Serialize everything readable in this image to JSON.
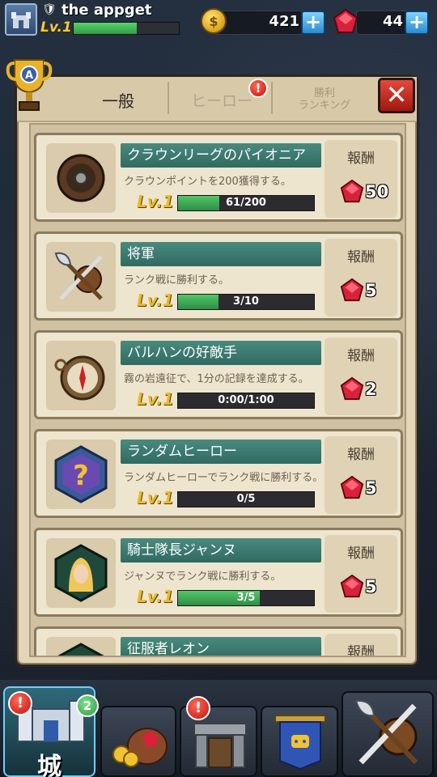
{
  "player": {
    "name": "the appget",
    "level": "Lv.1",
    "xp_fraction": 0.6
  },
  "currency": {
    "coins": "421",
    "gems": "44"
  },
  "tabs": {
    "general": "一般",
    "hero": "ヒーロー",
    "ranking_line1": "勝利",
    "ranking_line2": "ランキング",
    "alert": "!"
  },
  "quests": [
    {
      "title": "クラウンリーグのパイオニア",
      "description": "クラウンポイントを200獲得する。",
      "level": "Lv.1",
      "progress": "61/200",
      "progress_fraction": 0.305,
      "reward_label": "報酬",
      "reward_amount": "50",
      "icon": "shield-icon"
    },
    {
      "title": "将軍",
      "description": "ランク戦に勝利する。",
      "level": "Lv.1",
      "progress": "3/10",
      "progress_fraction": 0.3,
      "reward_label": "報酬",
      "reward_amount": "5",
      "icon": "crossed-weapons-icon"
    },
    {
      "title": "バルハンの好敵手",
      "description": "霧の岩遠征で、1分の記録を達成する。",
      "level": "Lv.1",
      "progress": "0:00/1:00",
      "progress_fraction": 0,
      "reward_label": "報酬",
      "reward_amount": "2",
      "icon": "compass-icon"
    },
    {
      "title": "ランダムヒーロー",
      "description": "ランダムヒーローでランク戦に勝利する。",
      "level": "Lv.1",
      "progress": "0/5",
      "progress_fraction": 0,
      "reward_label": "報酬",
      "reward_amount": "5",
      "icon": "question-mark-icon"
    },
    {
      "title": "騎士隊長ジャンヌ",
      "description": "ジャンヌでランク戦に勝利する。",
      "level": "Lv.1",
      "progress": "3/5",
      "progress_fraction": 0.6,
      "reward_label": "報酬",
      "reward_amount": "5",
      "icon": "hero-portrait-icon"
    },
    {
      "title": "征服者レオン",
      "description": "",
      "level": "",
      "progress": "",
      "progress_fraction": 0,
      "reward_label": "報酬",
      "reward_amount": "",
      "icon": "hero-portrait-icon"
    }
  ],
  "bottom_nav": {
    "castle_label": "城",
    "castle_alert": "!",
    "castle_count": "2",
    "dungeon_alert": "!"
  },
  "colors": {
    "accent_teal": "#2f6a61",
    "gem_red": "#c4122a",
    "level_gold": "#e8b92c",
    "progress_green": "#52c768"
  }
}
